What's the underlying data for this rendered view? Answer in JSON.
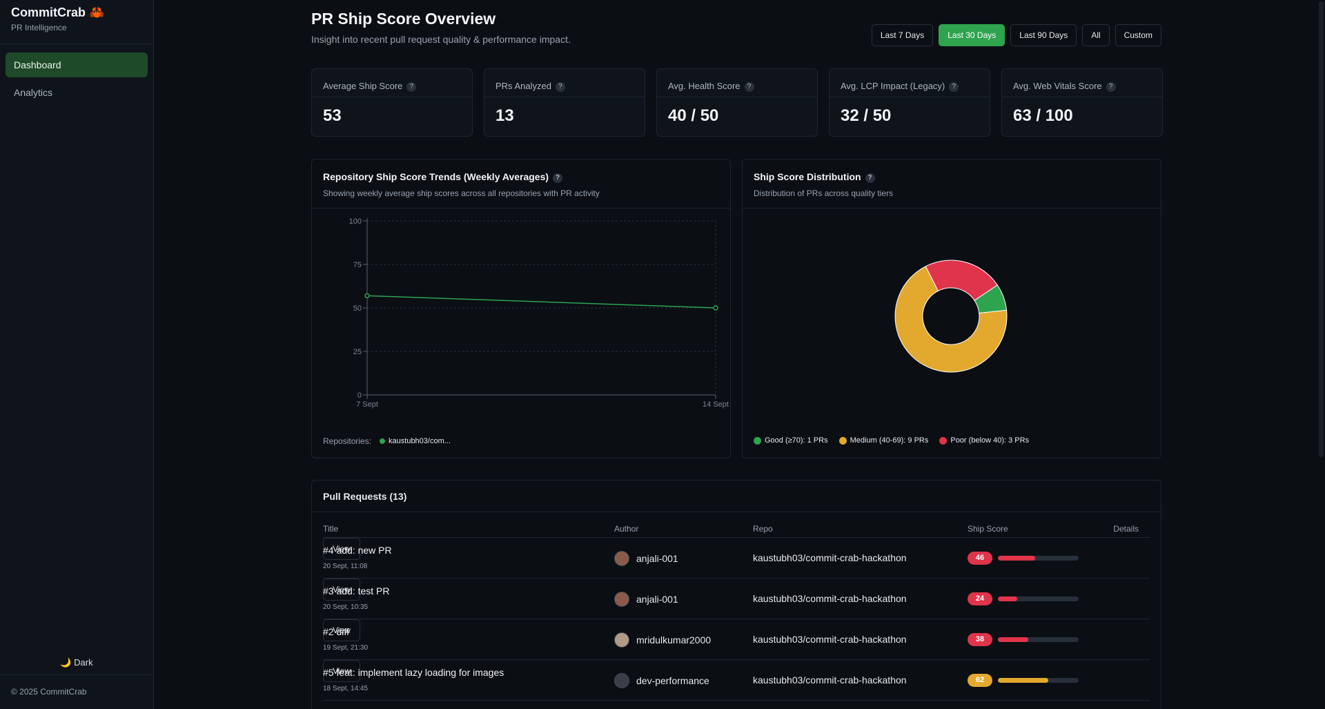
{
  "brand": {
    "title": "CommitCrab 🦀",
    "subtitle": "PR Intelligence"
  },
  "sidebar": {
    "items": [
      {
        "label": "Dashboard",
        "active": true
      },
      {
        "label": "Analytics",
        "active": false
      }
    ],
    "theme_toggle": "🌙 Dark",
    "footer": "© 2025 CommitCrab"
  },
  "header": {
    "title": "PR Ship Score Overview",
    "subtitle": "Insight into recent pull request quality & performance impact."
  },
  "ranges": {
    "items": [
      "Last 7 Days",
      "Last 30 Days",
      "Last 90 Days",
      "All",
      "Custom"
    ],
    "selected": "Last 30 Days"
  },
  "stats": [
    {
      "label": "Average Ship Score",
      "value": "53"
    },
    {
      "label": "PRs Analyzed",
      "value": "13"
    },
    {
      "label": "Avg. Health Score",
      "value": "40 / 50"
    },
    {
      "label": "Avg. LCP Impact (Legacy)",
      "value": "32 / 50"
    },
    {
      "label": "Avg. Web Vitals Score",
      "value": "63 / 100"
    }
  ],
  "trends": {
    "title": "Repository Ship Score Trends (Weekly Averages)",
    "subtitle": "Showing weekly average ship scores across all repositories with PR activity",
    "legend_label": "Repositories:",
    "legend_repo": "kaustubh03/com...",
    "series_color": "#2ea44f"
  },
  "distribution": {
    "title": "Ship Score Distribution",
    "subtitle": "Distribution of PRs across quality tiers",
    "legend": [
      {
        "label": "Good (≥70): 1 PRs",
        "color": "#2ea44f"
      },
      {
        "label": "Medium (40-69): 9 PRs",
        "color": "#e3a92f"
      },
      {
        "label": "Poor (below 40): 3 PRs",
        "color": "#e0344a"
      }
    ]
  },
  "chart_data": [
    {
      "type": "line",
      "x": [
        "7 Sept",
        "14 Sept"
      ],
      "series": [
        {
          "name": "kaustubh03/com...",
          "values": [
            57,
            50
          ]
        }
      ],
      "ylim": [
        0,
        100
      ],
      "yticks": [
        0,
        25,
        50,
        75,
        100
      ],
      "grid": true,
      "legend": "bottom"
    },
    {
      "type": "pie",
      "donut": true,
      "labels": [
        "Good (≥70)",
        "Medium (40-69)",
        "Poor (below 40)"
      ],
      "values": [
        1,
        9,
        3
      ],
      "colors": [
        "#2ea44f",
        "#e3a92f",
        "#e0344a"
      ],
      "legend": "bottom"
    }
  ],
  "table": {
    "title": "Pull Requests (13)",
    "columns": [
      "Title",
      "Author",
      "Repo",
      "Ship Score",
      "Details"
    ],
    "view_label": "View",
    "rows": [
      {
        "title": "#4 add: new PR",
        "date": "20 Sept, 11:08",
        "author": "anjali-001",
        "repo": "kaustubh03/commit-crab-hackathon",
        "score": "46",
        "level": 0.46,
        "color": "#e0344a"
      },
      {
        "title": "#3 add: test PR",
        "date": "20 Sept, 10:35",
        "author": "anjali-001",
        "repo": "kaustubh03/commit-crab-hackathon",
        "score": "24",
        "level": 0.24,
        "color": "#e0344a"
      },
      {
        "title": "#2 diff",
        "date": "19 Sept, 21:30",
        "author": "mridulkumar2000",
        "repo": "kaustubh03/commit-crab-hackathon",
        "score": "38",
        "level": 0.38,
        "color": "#e0344a"
      },
      {
        "title": "#5 feat: implement lazy loading for images",
        "date": "18 Sept, 14:45",
        "author": "dev-performance",
        "repo": "kaustubh03/commit-crab-hackathon",
        "score": "62",
        "level": 0.62,
        "color": "#e3a92f"
      }
    ]
  }
}
